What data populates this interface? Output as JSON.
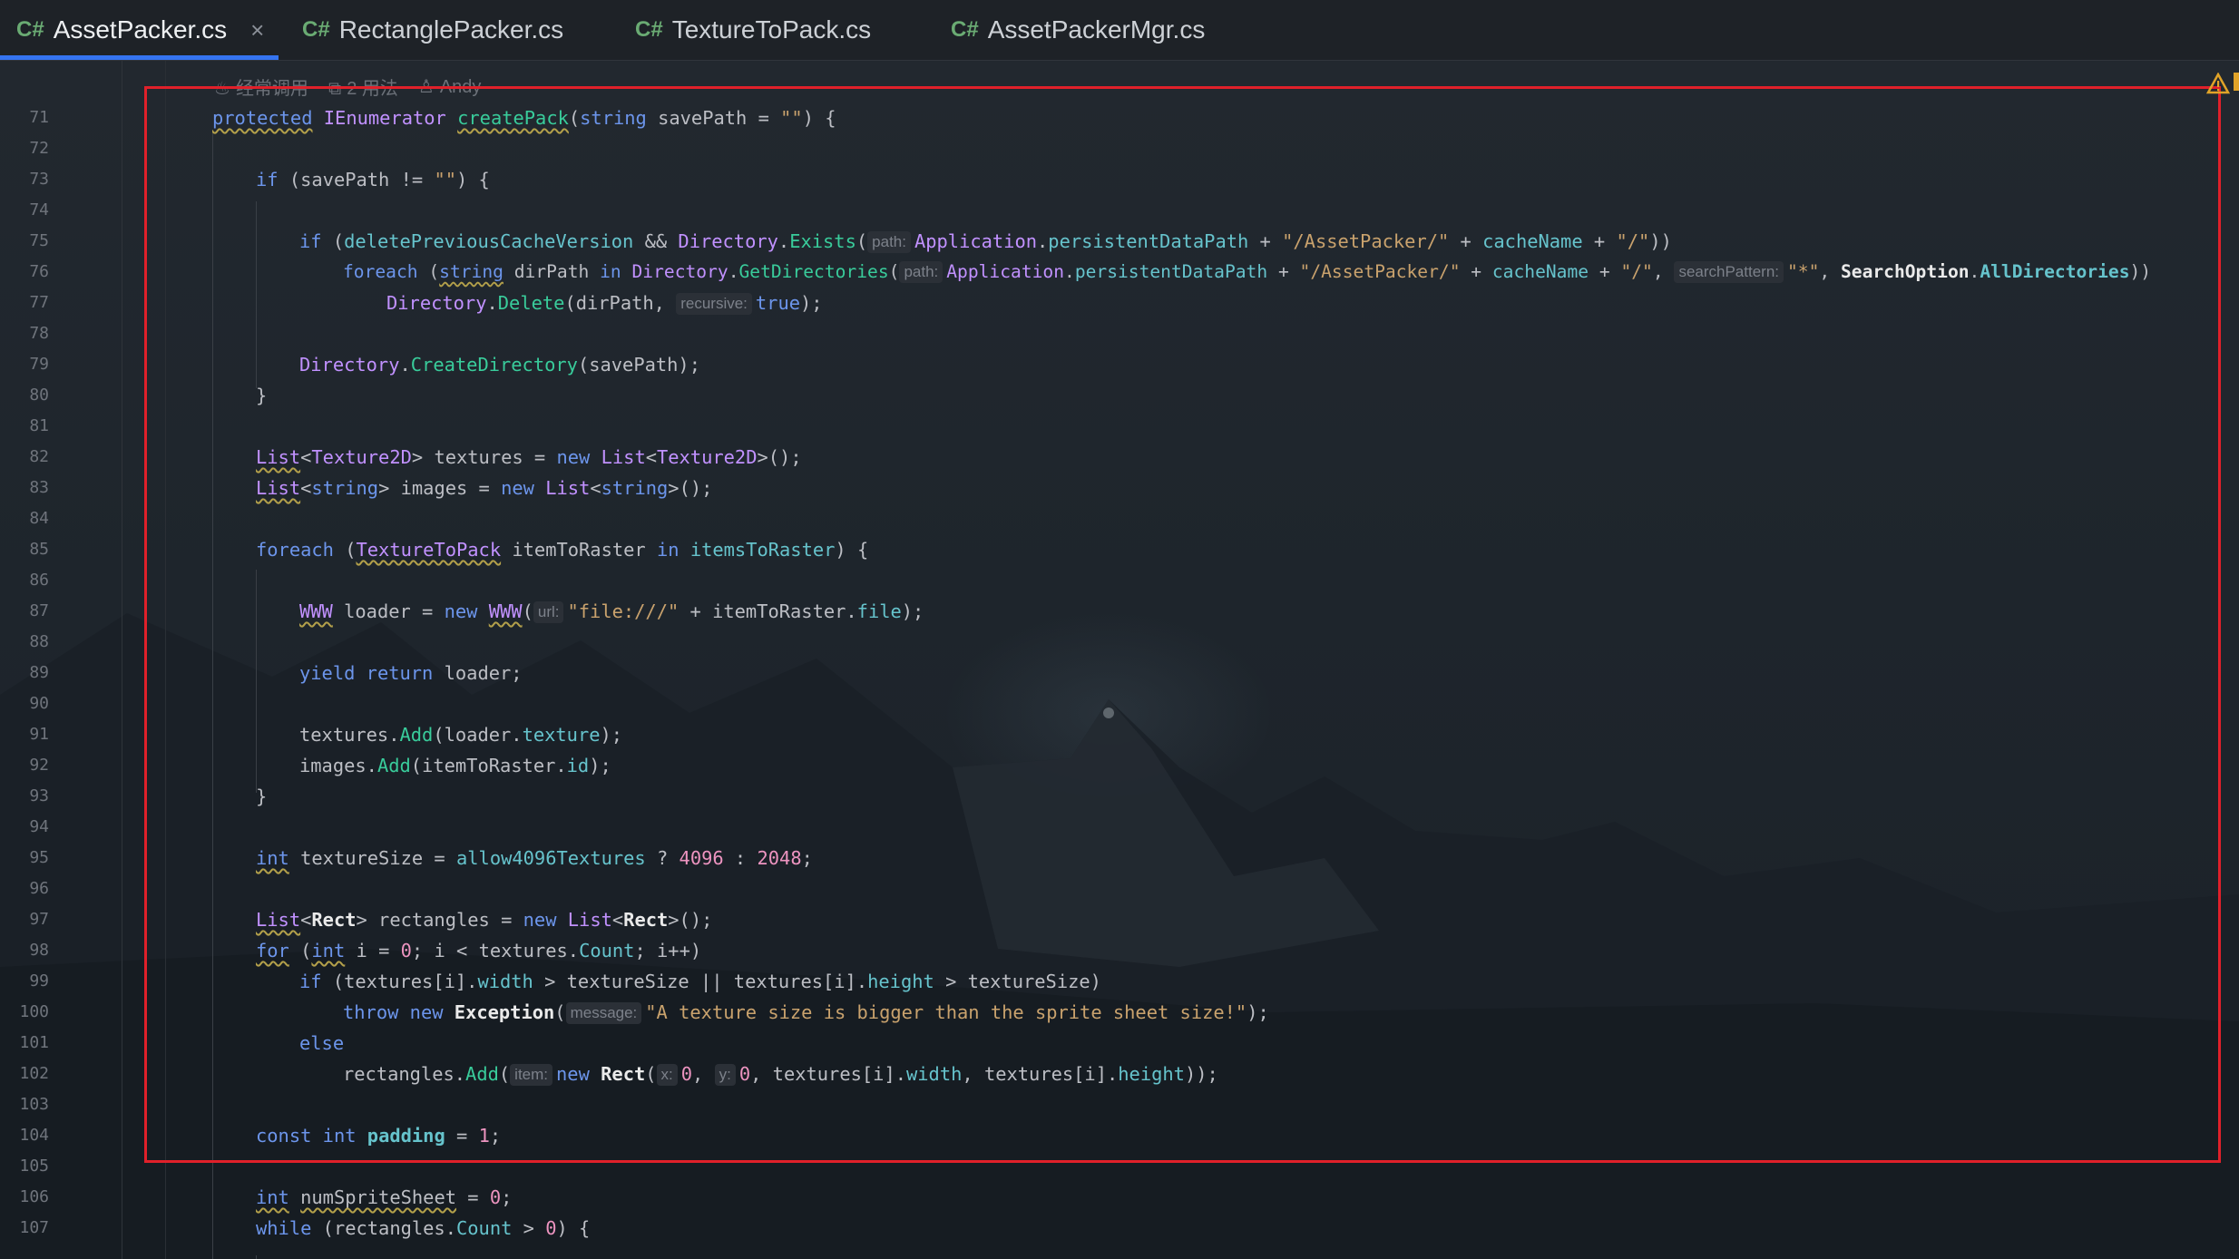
{
  "tabs": [
    {
      "lang": "C#",
      "name": "AssetPacker.cs",
      "active": true,
      "close": "×"
    },
    {
      "lang": "C#",
      "name": "RectanglePacker.cs"
    },
    {
      "lang": "C#",
      "name": "TextureToPack.cs"
    },
    {
      "lang": "C#",
      "name": "AssetPackerMgr.cs"
    }
  ],
  "colors": {
    "accent": "#3574f0",
    "highlight_box": "#e0202a",
    "warning": "#e0a328"
  },
  "hints_bar": {
    "usage": "经常调用",
    "usages_count": "2 用法",
    "author": "Andy"
  },
  "line_numbers": [
    "71",
    "72",
    "73",
    "74",
    "75",
    "76",
    "77",
    "78",
    "79",
    "80",
    "81",
    "82",
    "83",
    "84",
    "85",
    "86",
    "87",
    "88",
    "89",
    "90",
    "91",
    "92",
    "93",
    "94",
    "95",
    "96",
    "97",
    "98",
    "99",
    "100",
    "101",
    "102",
    "103",
    "104",
    "105",
    "106",
    "107"
  ],
  "code": {
    "l71": {
      "mod": "protected",
      "ret": "IEnumerator",
      "fn": "createPack",
      "open": "(",
      "ptype": "string",
      "rest": " savePath = ",
      "str": "\"\"",
      "tail": ") {"
    },
    "l73": {
      "kw": "if",
      "rest": " (savePath != ",
      "str": "\"\"",
      "tail": ") {"
    },
    "l75": {
      "kw": "if",
      "a": " (",
      "v1": "deletePreviousCacheVersion",
      "b": " && ",
      "c1": "Directory",
      "d": ".",
      "m1": "Exists",
      "e": "(",
      "h1": "path:",
      "c2": "Application",
      "f": ".",
      "p1": "persistentDataPath",
      "g": " + ",
      "s1": "\"/AssetPacker/\"",
      "g2": " + ",
      "p2": "cacheName",
      "g3": " + ",
      "s2": "\"/\"",
      "tail": "))"
    },
    "l76": {
      "kw": "foreach",
      "a": " (",
      "t": "string",
      "b": " dirPath ",
      "in": "in",
      "c": " ",
      "c1": "Directory",
      "d": ".",
      "m1": "GetDirectories",
      "e": "(",
      "h1": "path:",
      "c2": "Application",
      "f": ".",
      "p1": "persistentDataPath",
      "g": " + ",
      "s1": "\"/AssetPacker/\"",
      "g2": " + ",
      "p2": "cacheName",
      "g3": " + ",
      "s2": "\"/\"",
      "g4": ", ",
      "h2": "searchPattern:",
      "s3": "\"*\"",
      "g5": ", ",
      "c3": "SearchOption",
      "f2": ".",
      "p3": "AllDirectories",
      "tail": "))"
    },
    "l77": {
      "c1": "Directory",
      "d": ".",
      "m1": "Delete",
      "a": "(dirPath, ",
      "h1": "recursive:",
      "v": "true",
      "tail": ");"
    },
    "l79": {
      "c1": "Directory",
      "d": ".",
      "m1": "CreateDirectory",
      "tail": "(savePath);"
    },
    "l80": {
      "t": "}"
    },
    "l82": {
      "c1": "List",
      "a": "<",
      "c2": "Texture2D",
      "b": "> textures = ",
      "kw": "new",
      "c": " ",
      "c3": "List",
      "d": "<",
      "c4": "Texture2D",
      "tail": ">();"
    },
    "l83": {
      "c1": "List",
      "a": "<",
      "c2": "string",
      "b": "> images = ",
      "kw": "new",
      "c": " ",
      "c3": "List",
      "d": "<",
      "c4": "string",
      "tail": ">();"
    },
    "l85": {
      "kw": "foreach",
      "a": " (",
      "c1": "TextureToPack",
      "b": " itemToRaster ",
      "in": "in",
      "c": " ",
      "p1": "itemsToRaster",
      "tail": ") {"
    },
    "l87": {
      "c1": "WWW",
      "a": " loader = ",
      "kw": "new",
      "b": " ",
      "c2": "WWW",
      "c": "(",
      "h1": "url:",
      "s1": "\"file:///\"",
      "d": " + itemToRaster.",
      "p1": "file",
      "tail": ");"
    },
    "l89": {
      "kw1": "yield",
      "a": " ",
      "kw2": "return",
      "tail": " loader;"
    },
    "l91": {
      "a": "textures.",
      "m1": "Add",
      "b": "(loader.",
      "p1": "texture",
      "tail": ");"
    },
    "l92": {
      "a": "images.",
      "m1": "Add",
      "b": "(itemToRaster.",
      "p1": "id",
      "tail": ");"
    },
    "l93": {
      "t": "}"
    },
    "l95": {
      "t1": "int",
      "a": " textureSize = ",
      "p1": "allow4096Textures",
      "b": " ? ",
      "n1": "4096",
      "c": " : ",
      "n2": "2048",
      "tail": ";"
    },
    "l97": {
      "c1": "List",
      "a": "<",
      "c2": "Rect",
      "b": "> rectangles = ",
      "kw": "new",
      "c": " ",
      "c3": "List",
      "d": "<",
      "c4": "Rect",
      "tail": ">();"
    },
    "l98": {
      "kw": "for",
      "a": " (",
      "t1": "int",
      "b": " i = ",
      "n1": "0",
      "c": "; i < textures.",
      "p1": "Count",
      "tail": "; i++)"
    },
    "l99": {
      "kw": "if",
      "a": " (textures[i].",
      "p1": "width",
      "b": " > textureSize || textures[i].",
      "p2": "height",
      "tail": " > textureSize)"
    },
    "l100": {
      "kw1": "throw",
      "a": " ",
      "kw2": "new",
      "b": " ",
      "c1": "Exception",
      "c": "(",
      "h1": "message:",
      "s1": "\"A texture size is bigger than the sprite sheet size!\"",
      "tail": ");"
    },
    "l101": {
      "kw": "else"
    },
    "l102": {
      "a": "rectangles.",
      "m1": "Add",
      "b": "(",
      "h1": "item:",
      "kw": "new",
      "c": " ",
      "c1": "Rect",
      "d": "(",
      "h2": "x:",
      "n1": "0",
      "e": ", ",
      "h3": "y:",
      "n2": "0",
      "f": ", textures[i].",
      "p1": "width",
      "g": ", textures[i].",
      "p2": "height",
      "tail": "));"
    },
    "l104": {
      "kw1": "const",
      "a": " ",
      "kw2": "int",
      "b": " ",
      "v": "padding",
      "c": " = ",
      "n1": "1",
      "tail": ";"
    },
    "l106": {
      "t1": "int",
      "a": " ",
      "v": "numSpriteSheet",
      "b": " = ",
      "n1": "0",
      "tail": ";"
    },
    "l107": {
      "kw": "while",
      "a": " (rectangles.",
      "p1": "Count",
      "b": " > ",
      "n1": "0",
      "tail": ") {"
    }
  }
}
